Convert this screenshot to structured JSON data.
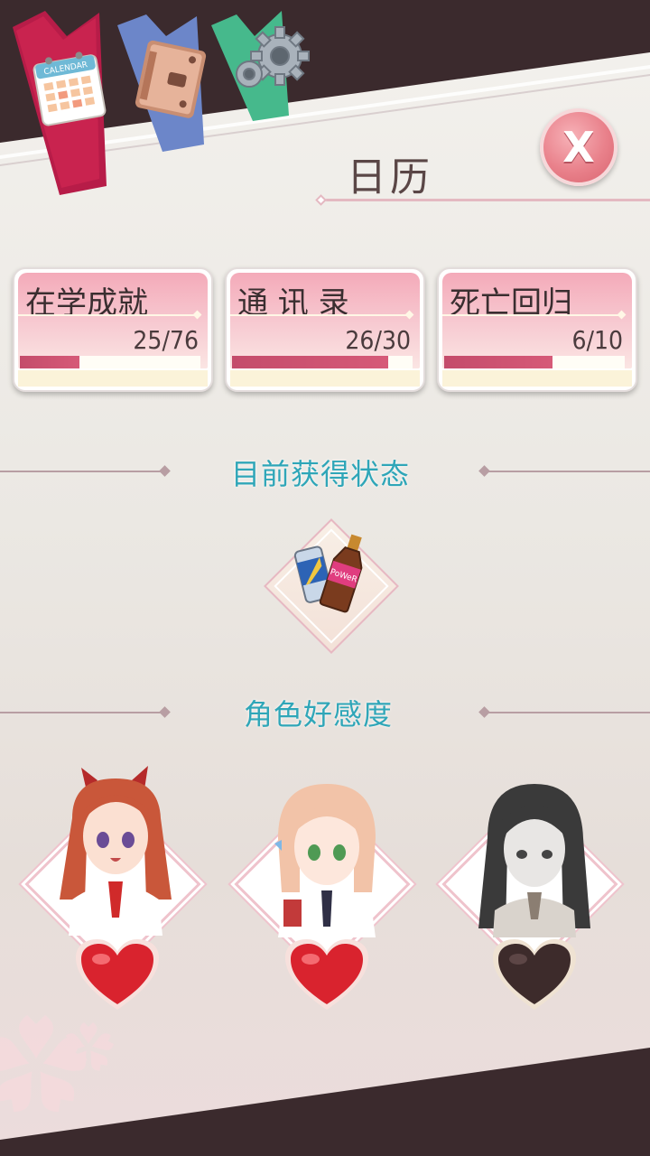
{
  "header": {
    "tabs": [
      {
        "name": "calendar",
        "icon": "calendar-icon",
        "color": "#b71c48",
        "calendar_label": "CALENDAR"
      },
      {
        "name": "notebook",
        "icon": "notebook-icon",
        "color": "#6c86c9"
      },
      {
        "name": "settings",
        "icon": "gear-icon",
        "color": "#46b98c"
      }
    ],
    "title": "日历",
    "close_label": "X"
  },
  "stats": [
    {
      "label": "在学成就",
      "value": "25/76",
      "progress": 0.329
    },
    {
      "label": "通 讯 录",
      "value": "26/30",
      "progress": 0.867
    },
    {
      "label": "死亡回归",
      "value": "6/10",
      "progress": 0.6
    }
  ],
  "status_section": {
    "title": "目前获得状态",
    "items": [
      {
        "icon": "energy-drink-icon",
        "bottle_label": "PoWeR"
      }
    ]
  },
  "affinity_section": {
    "title": "角色好感度",
    "characters": [
      {
        "name": "red-haired-girl",
        "hair": "#c9573a",
        "heart": "red"
      },
      {
        "name": "pink-haired-girl",
        "hair": "#f2c3a8",
        "heart": "red"
      },
      {
        "name": "black-haired-girl",
        "hair": "#3a3a3a",
        "heart": "dark"
      }
    ]
  },
  "colors": {
    "accent": "#2fa6b8",
    "bar": "#c44c6b",
    "card": "#f4aab9",
    "frame": "#3b2a2d"
  }
}
